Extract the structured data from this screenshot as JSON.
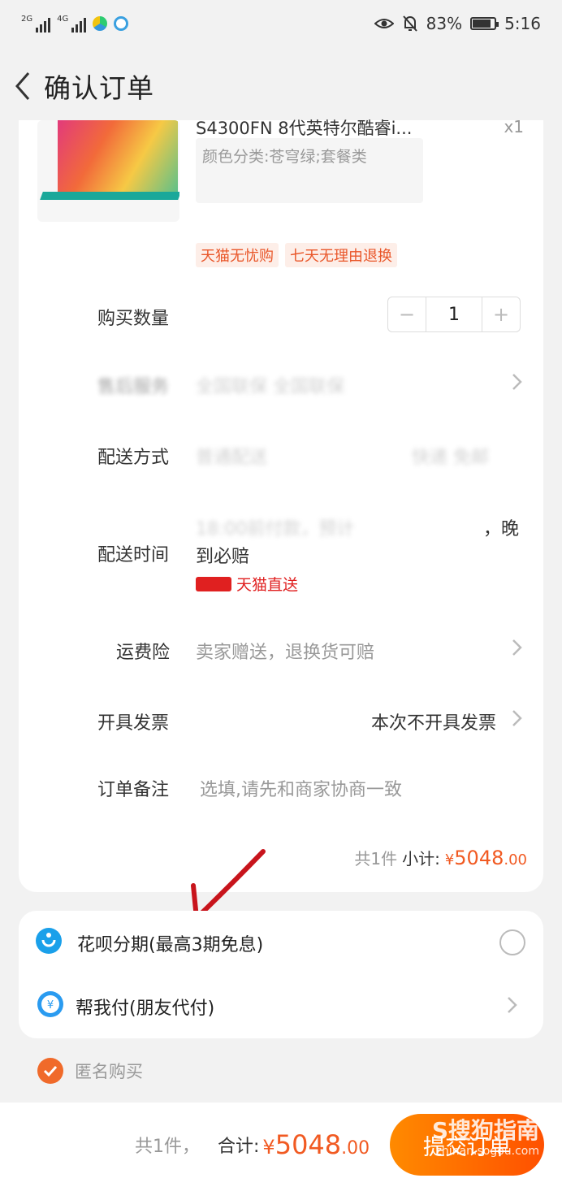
{
  "status_bar": {
    "net1": "2G",
    "net2": "4G",
    "battery": "83%",
    "time": "5:16"
  },
  "header": {
    "title": "确认订单"
  },
  "product": {
    "title": "S4300FN 8代英特尔酷睿i...",
    "qty": "x1",
    "sku": "颜色分类:苍穹绿;套餐类",
    "tags": [
      "天猫无忧购",
      "七天无理由退换"
    ]
  },
  "order": {
    "quantity": {
      "label": "购买数量",
      "minus": "−",
      "value": "1",
      "plus": "+"
    },
    "after_sale": {
      "label": "售后服务",
      "value": "全国联保 全国联保"
    },
    "delivery": {
      "label": "配送方式",
      "value": "普通配送",
      "value2": "快递 免邮"
    },
    "delivery_time": {
      "label": "配送时间",
      "line1": "18:00前付款，预计",
      "line1_tail": "，晚",
      "line2": "到必赔",
      "badge": "天猫直送"
    },
    "freight_insurance": {
      "label": "运费险",
      "value": "卖家赠送，退换货可赔"
    },
    "invoice": {
      "label": "开具发票",
      "value": "本次不开具发票"
    },
    "remark": {
      "label": "订单备注",
      "placeholder": "选填,请先和商家协商一致"
    },
    "subtotal": {
      "count": "共1件",
      "label": "小计:",
      "currency": "¥",
      "integer": "5048",
      "decimal": ".00"
    }
  },
  "payment": {
    "huabei": {
      "label": "花呗分期(最高3期免息)"
    },
    "friend_pay": {
      "label": "帮我付(朋友代付)"
    }
  },
  "anonymous": {
    "label": "匿名购买",
    "checked": true
  },
  "footer": {
    "count": "共1件，",
    "total_label": "合计:",
    "currency": "¥",
    "integer": "5048",
    "decimal": ".00",
    "submit": "提交订单"
  },
  "watermark": {
    "line1": "S搜狗指南",
    "line2": "zhinan.sogou.com"
  },
  "colors": {
    "accent": "#f15a22",
    "tmall_red": "#e02020",
    "annotation_arrow": "#c8141c"
  }
}
